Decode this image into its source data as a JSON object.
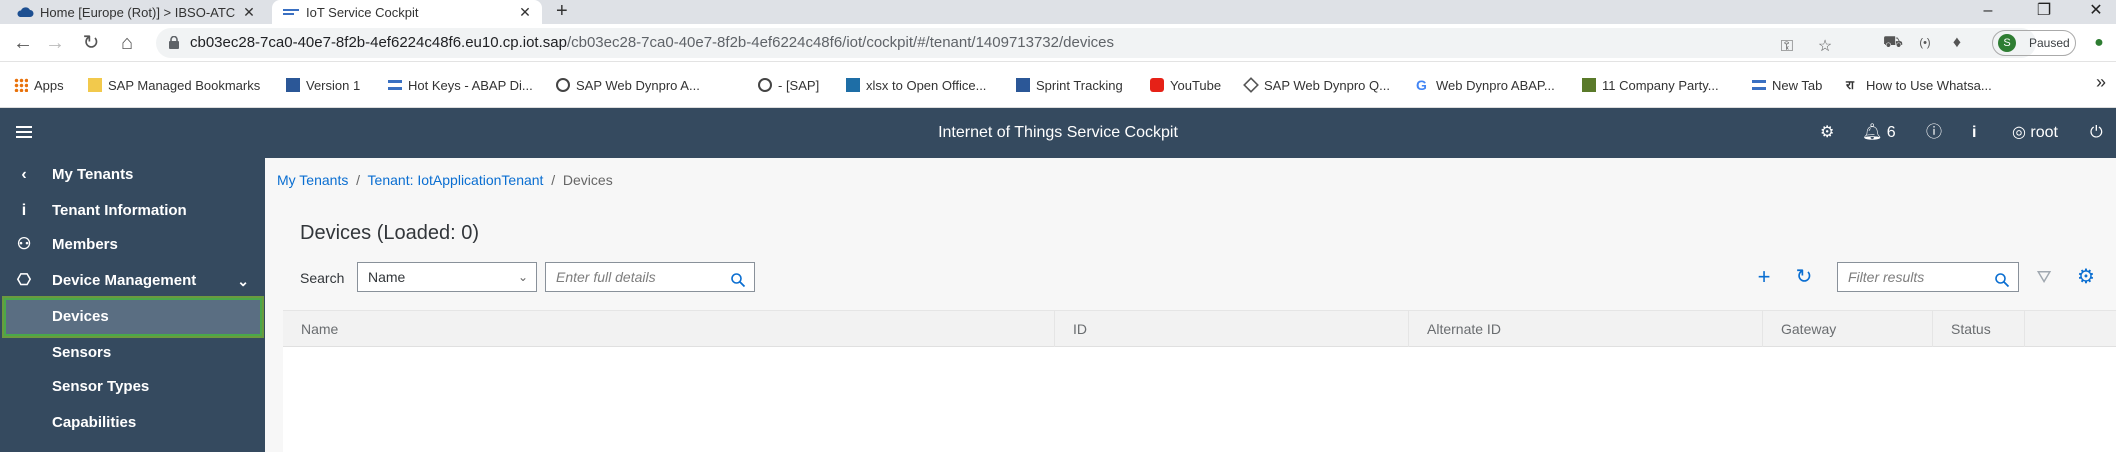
{
  "browser": {
    "tabs": [
      {
        "title": "Home [Europe (Rot)] > IBSO-ATC",
        "active": false
      },
      {
        "title": "IoT Service Cockpit",
        "active": true
      }
    ],
    "new_tab": "+",
    "window_controls": {
      "minimize": "–",
      "restore": "❐",
      "close": "✕"
    },
    "url_host": "cb03ec28-7ca0-40e7-8f2b-4ef6224c48f6.eu10.cp.iot.sap",
    "url_path": "/cb03ec28-7ca0-40e7-8f2b-4ef6224c48f6/iot/cockpit/#/tenant/1409713732/devices",
    "profile_label": "Paused",
    "profile_initial": "S",
    "bookmarks": [
      "Apps",
      "SAP Managed Bookmarks",
      "Version 1",
      "Hot Keys - ABAP Di...",
      "SAP Web Dynpro A...",
      "- [SAP]",
      "xlsx to Open Office...",
      "Sprint Tracking",
      "YouTube",
      "SAP Web Dynpro Q...",
      "Web Dynpro ABAP...",
      "11 Company Party...",
      "New Tab",
      "How to Use Whatsa..."
    ],
    "bookmarks_more": "»"
  },
  "shell": {
    "title": "Internet of Things Service Cockpit",
    "notification_count": "6",
    "user": "root"
  },
  "sidebar": {
    "items": [
      {
        "label": "My Tenants",
        "icon": "chevron-left-icon"
      },
      {
        "label": "Tenant Information",
        "icon": "info-icon"
      },
      {
        "label": "Members",
        "icon": "members-icon"
      },
      {
        "label": "Device Management",
        "icon": "device-management-icon"
      },
      {
        "label": "Devices",
        "icon": ""
      },
      {
        "label": "Sensors",
        "icon": ""
      },
      {
        "label": "Sensor Types",
        "icon": ""
      },
      {
        "label": "Capabilities",
        "icon": ""
      }
    ]
  },
  "breadcrumb": {
    "items": [
      "My Tenants",
      "Tenant: IotApplicationTenant",
      "Devices"
    ],
    "separator": "/"
  },
  "page": {
    "title": "Devices (Loaded: 0)",
    "search_label": "Search",
    "search_field_value": "Name",
    "search_details_placeholder": "Enter full details",
    "filter_placeholder": "Filter results"
  },
  "table": {
    "columns": [
      "Name",
      "ID",
      "Alternate ID",
      "Gateway",
      "Status"
    ]
  },
  "colors": {
    "shell": "#354a5f",
    "accent": "#0a6ed1",
    "selection_border": "#4aa84a"
  }
}
